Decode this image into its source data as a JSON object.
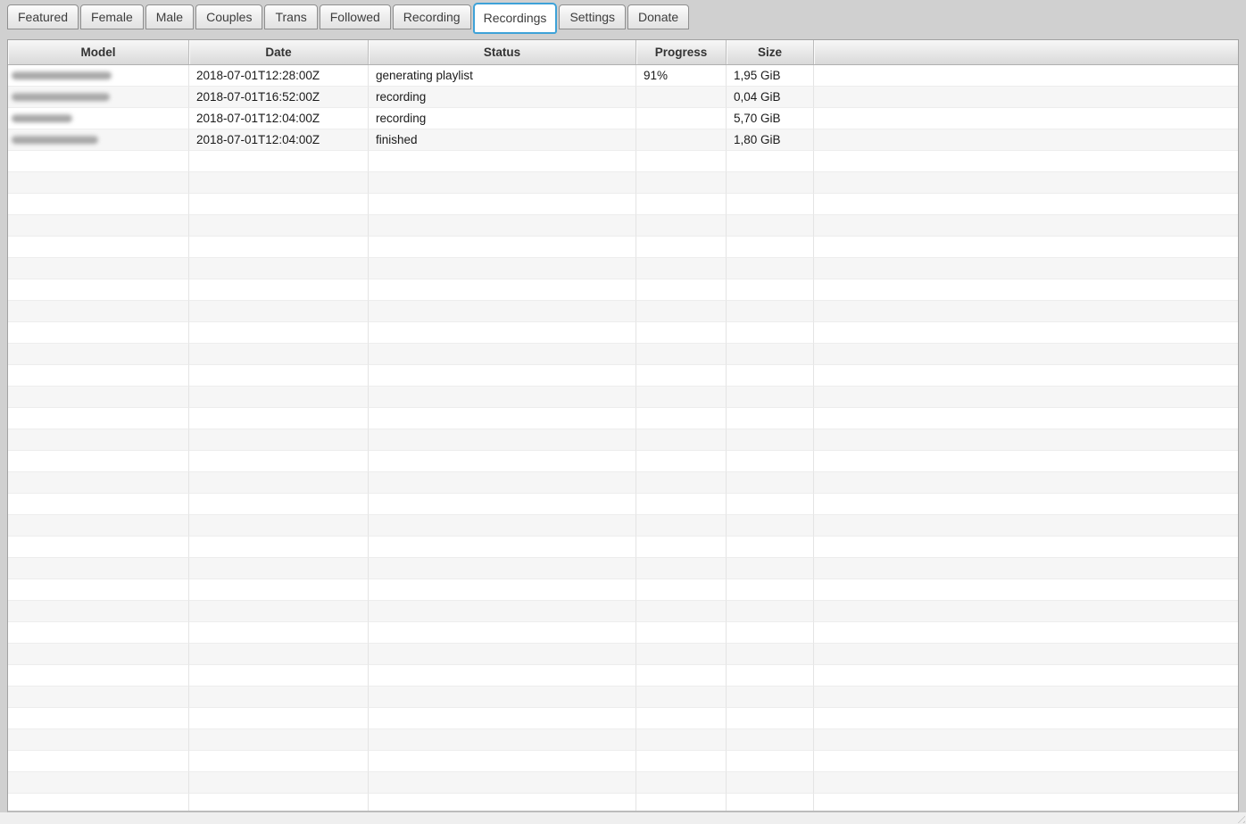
{
  "tabs": {
    "items": [
      {
        "label": "Featured",
        "active": false
      },
      {
        "label": "Female",
        "active": false
      },
      {
        "label": "Male",
        "active": false
      },
      {
        "label": "Couples",
        "active": false
      },
      {
        "label": "Trans",
        "active": false
      },
      {
        "label": "Followed",
        "active": false
      },
      {
        "label": "Recording",
        "active": false
      },
      {
        "label": "Recordings",
        "active": true
      },
      {
        "label": "Settings",
        "active": false
      },
      {
        "label": "Donate",
        "active": false
      }
    ]
  },
  "table": {
    "columns": [
      {
        "key": "model",
        "label": "Model"
      },
      {
        "key": "date",
        "label": "Date"
      },
      {
        "key": "status",
        "label": "Status"
      },
      {
        "key": "progress",
        "label": "Progress"
      },
      {
        "key": "size",
        "label": "Size"
      },
      {
        "key": "filler",
        "label": ""
      }
    ],
    "rows": [
      {
        "model_redacted": true,
        "model_blur_width": 112,
        "date": "2018-07-01T12:28:00Z",
        "status": "generating playlist",
        "progress": "91%",
        "size": "1,95 GiB"
      },
      {
        "model_redacted": true,
        "model_blur_width": 110,
        "date": "2018-07-01T16:52:00Z",
        "status": "recording",
        "progress": "",
        "size": "0,04 GiB"
      },
      {
        "model_redacted": true,
        "model_blur_width": 68,
        "date": "2018-07-01T12:04:00Z",
        "status": "recording",
        "progress": "",
        "size": "5,70 GiB"
      },
      {
        "model_redacted": true,
        "model_blur_width": 97,
        "date": "2018-07-01T12:04:00Z",
        "status": "finished",
        "progress": "",
        "size": "1,80 GiB"
      }
    ],
    "empty_row_count": 31
  },
  "colors": {
    "window_bg": "#d0d0d0",
    "active_tab_border": "#3ea2d8",
    "row_alt_bg": "#f6f6f6",
    "header_text": "#333333"
  }
}
